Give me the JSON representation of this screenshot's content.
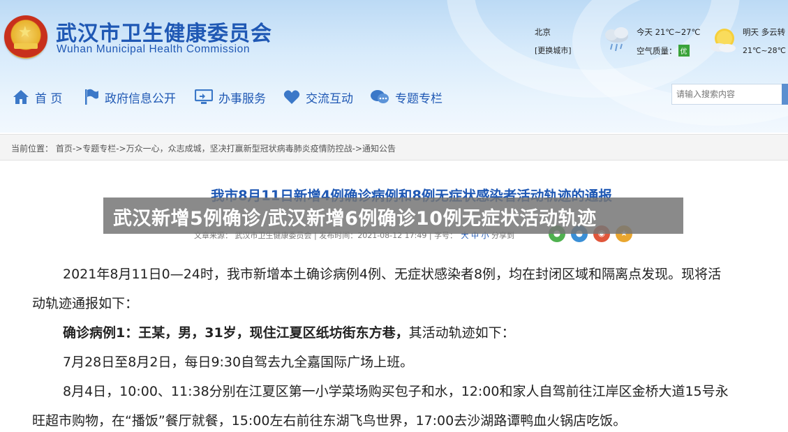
{
  "header": {
    "title_cn": "武汉市卫生健康委员会",
    "title_en": "Wuhan Municipal Health Commission"
  },
  "weather": {
    "city": "北京",
    "change_city": "[更换城市]",
    "today": "今天  21℃~27℃",
    "air_quality_label": "空气质量：",
    "air_quality_value": "优",
    "tomorrow": "明天  多云转",
    "tomorrow_temp": "21℃~28℃",
    "icons": [
      "cloud-rain-icon",
      "sun-cloud-icon"
    ]
  },
  "nav": {
    "items": [
      {
        "label": "首 页",
        "icon": "home-icon"
      },
      {
        "label": "政府信息公开",
        "icon": "flag-icon"
      },
      {
        "label": "办事服务",
        "icon": "monitor-icon"
      },
      {
        "label": "交流互动",
        "icon": "heart-icon"
      },
      {
        "label": "专题专栏",
        "icon": "chat-icon"
      }
    ],
    "search_placeholder": "请输入搜索内容"
  },
  "breadcrumb": {
    "text": "当前位置： 首页->专题专栏->万众一心，众志成城，坚决打赢新型冠状病毒肺炎疫情防控战->通知公告"
  },
  "article": {
    "title": "我市8月11日新增4例确诊病例和8例无症状感染者活动轨迹的通报",
    "meta": "文章来源： 武汉市卫生健康委员会 | 发布时间：2021-08-12 17:49 | 字号：",
    "font_sizes": "大 中 小",
    "share_label": "分享到",
    "share_icons": [
      "wechat-icon",
      "qq-icon",
      "weibo-icon",
      "favorite-icon"
    ],
    "overlay": "武汉新增5例确诊/武汉新增6例确诊10例无症状活动轨迹",
    "paragraphs": {
      "p1_line1": "2021年8月11日0—24时，我市新增本土确诊病例4例、无症状感染者8例，均在封闭区域和隔离点发现。现将活",
      "p1_line2": "动轨迹通报如下：",
      "case1_bold": "确诊病例1：王某，男，31岁，现住江夏区纸坊街东方巷，",
      "case1_rest": "其活动轨迹如下：",
      "p2": "7月28日至8月2日，每日9:30自驾去九全嘉国际广场上班。",
      "p3_line1": "8月4日，10:00、11:38分别在江夏区第一小学菜场购买包子和水，12:00和家人自驾前往江岸区金桥大道15号永",
      "p3_line2": "旺超市购物，在“播饭”餐厅就餐，15:00左右前往东湖飞鸟世界，17:00去沙湖路谭鸭血火锅店吃饭。"
    }
  },
  "colors": {
    "brand_blue": "#1f58b4",
    "air_quality_good": "#3aa33a"
  }
}
